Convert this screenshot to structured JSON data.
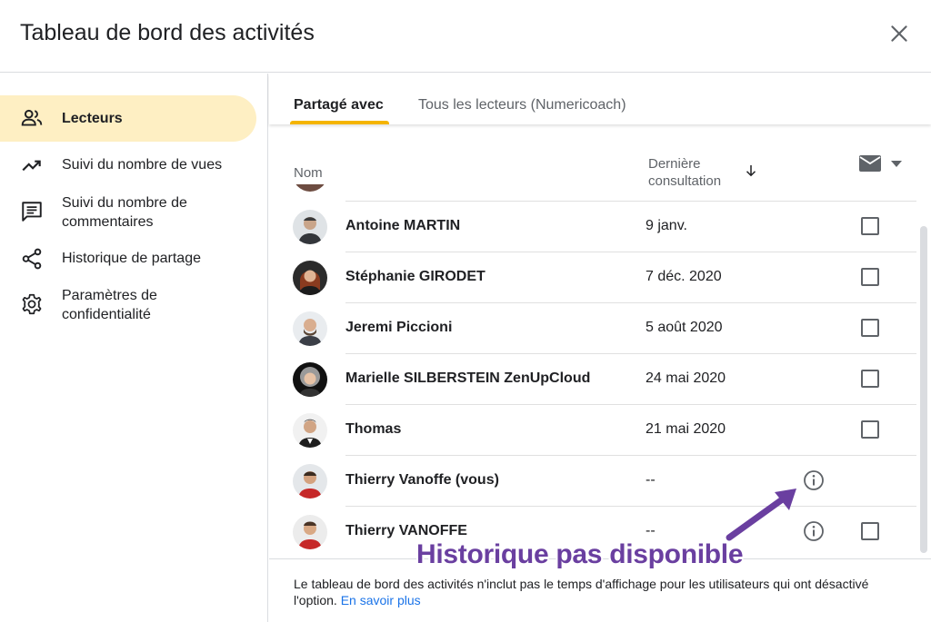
{
  "dialog": {
    "title": "Tableau de bord des activités",
    "close_icon": "close-icon"
  },
  "sidebar": {
    "items": [
      {
        "label": "Lecteurs",
        "icon": "people-icon",
        "active": true
      },
      {
        "label": "Suivi du nombre de vues",
        "icon": "trending-up-icon",
        "active": false
      },
      {
        "label": "Suivi du nombre de commentaires",
        "icon": "comment-icon",
        "active": false
      },
      {
        "label": "Historique de partage",
        "icon": "share-icon",
        "active": false
      },
      {
        "label": "Paramètres de confidentialité",
        "icon": "gear-icon",
        "active": false
      }
    ]
  },
  "tabs": [
    {
      "label": "Partagé avec",
      "active": true
    },
    {
      "label": "Tous les lecteurs (Numericoach)",
      "active": false
    }
  ],
  "table": {
    "columns": {
      "name": "Nom",
      "last_view": "Dernière consultation"
    },
    "rows": [
      {
        "name": "Antoine MARTIN",
        "date": "9 janv.",
        "checkbox": true,
        "info": false
      },
      {
        "name": "Stéphanie GIRODET",
        "date": "7 déc. 2020",
        "checkbox": true,
        "info": false
      },
      {
        "name": "Jeremi Piccioni",
        "date": "5 août 2020",
        "checkbox": true,
        "info": false
      },
      {
        "name": "Marielle SILBERSTEIN ZenUpCloud",
        "date": "24 mai 2020",
        "checkbox": true,
        "info": false
      },
      {
        "name": "Thomas",
        "date": "21 mai 2020",
        "checkbox": true,
        "info": false
      },
      {
        "name": "Thierry Vanoffe (vous)",
        "date": "--",
        "checkbox": false,
        "info": true
      },
      {
        "name": "Thierry VANOFFE",
        "date": "--",
        "checkbox": true,
        "info": true
      }
    ]
  },
  "footer": {
    "text": "Le tableau de bord des activités n'inclut pas le temps d'affichage pour les utilisateurs qui ont désactivé l'option.",
    "link": "En savoir plus"
  },
  "annotation": {
    "text": "Historique pas disponible"
  },
  "colors": {
    "active_bg": "#feefc3",
    "tab_accent": "#f4b400",
    "link": "#1a73e8",
    "annotation": "#6a3fa0"
  }
}
